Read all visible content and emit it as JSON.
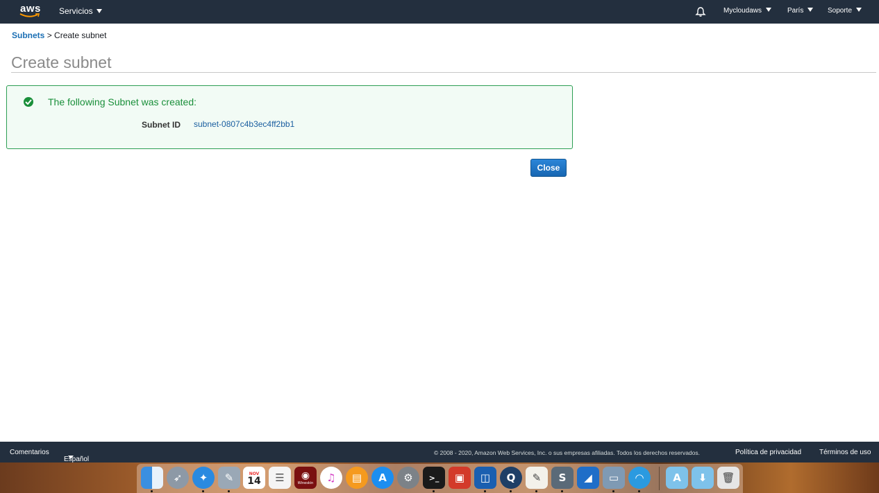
{
  "topnav": {
    "logo": "aws",
    "services": "Servicios",
    "account": "Mycloudaws",
    "region": "París",
    "support": "Soporte"
  },
  "breadcrumb": {
    "parent": "Subnets",
    "separator": ">",
    "current": "Create subnet"
  },
  "page": {
    "title": "Create subnet"
  },
  "success": {
    "message": "The following Subnet was created:",
    "label": "Subnet ID",
    "value": "subnet-0807c4b3ec4ff2bb1"
  },
  "actions": {
    "close": "Close"
  },
  "footer": {
    "feedback": "Comentarios",
    "language": "Español",
    "copyright": "© 2008 - 2020, Amazon Web Services, Inc. o sus empresas afiliadas. Todos los derechos reservados.",
    "privacy": "Política de privacidad",
    "terms": "Términos de uso"
  },
  "dock": {
    "calendar_month": "NOV",
    "calendar_day": "14",
    "wineskin_label": "Wineskin"
  },
  "colors": {
    "nav_bg": "#232f3e",
    "link": "#1b6fb4",
    "success": "#1a8f3a",
    "button": "#1766b2"
  }
}
